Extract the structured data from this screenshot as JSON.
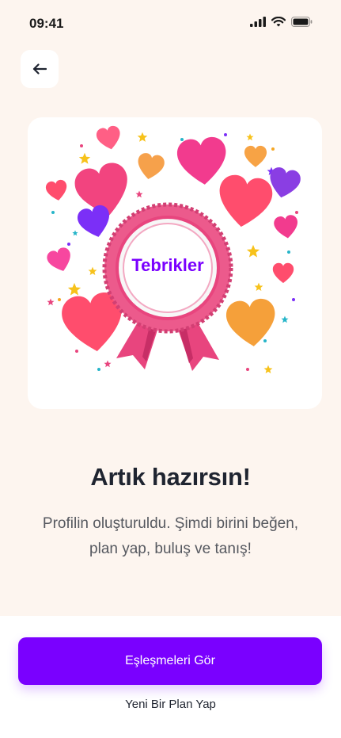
{
  "status_bar": {
    "time": "09:41"
  },
  "header": {
    "back_icon": "arrow-left-icon"
  },
  "hero": {
    "badge_text": "Tebrikler"
  },
  "content": {
    "title": "Artık hazırsın!",
    "subtitle_line1": "Profilin oluşturuldu. Şimdi birini beğen,",
    "subtitle_line2": "plan yap, buluş ve tanış!"
  },
  "actions": {
    "primary_label": "Eşleşmeleri Gör",
    "secondary_label": "Yeni Bir Plan Yap"
  },
  "colors": {
    "accent": "#7a00ff",
    "background": "#fdf5ef",
    "badge_pink": "#e8457e"
  }
}
